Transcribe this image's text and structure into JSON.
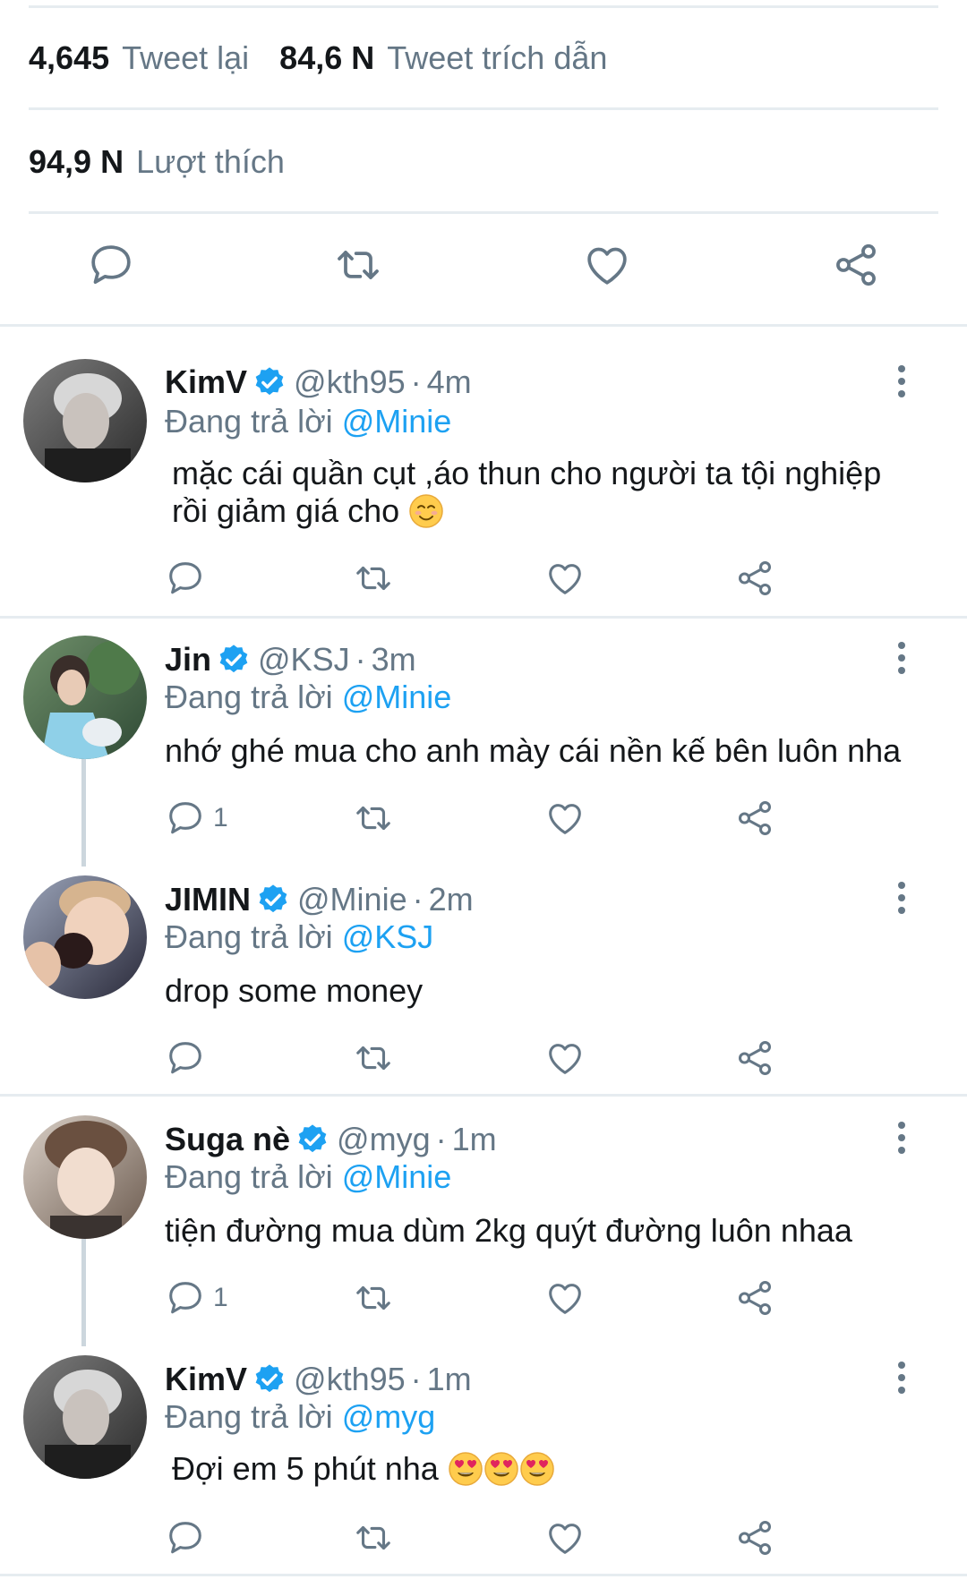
{
  "stats": {
    "retweets_count": "4,645",
    "retweets_label": "Tweet lại",
    "quotes_count": "84,6 N",
    "quotes_label": "Tweet trích dẫn",
    "likes_count": "94,9 N",
    "likes_label": "Lượt thích"
  },
  "colors": {
    "accent": "#1da1f2",
    "muted": "#657786",
    "icon": "#657786",
    "divider": "#e6ecf0",
    "text": "#14171a"
  },
  "icons": {
    "reply": "speech-bubble-icon",
    "retweet": "retweet-arrows-icon",
    "like": "heart-icon",
    "share": "share-nodes-icon",
    "verified": "verified-badge-icon",
    "more": "vertical-ellipsis-icon"
  },
  "replying_prefix": "Đang trả lời",
  "tweets": [
    {
      "name": "KimV",
      "handle": "@kth95",
      "time": "4m",
      "reply_to": "@Minie",
      "text": "mặc cái quần cụt ,áo thun cho người ta tội nghiệp rồi giảm giá cho",
      "emoji": [
        "smiling-face-emoji"
      ],
      "reply_count": ""
    },
    {
      "name": "Jin",
      "handle": "@KSJ",
      "time": "3m",
      "reply_to": "@Minie",
      "text": "nhớ ghé mua cho anh mày cái nền kế bên luôn nha",
      "emoji": [],
      "reply_count": "1"
    },
    {
      "name": "JIMIN",
      "handle": "@Minie",
      "time": "2m",
      "reply_to": "@KSJ",
      "text": "drop some money",
      "emoji": [],
      "reply_count": ""
    },
    {
      "name": "Suga nè",
      "handle": "@myg",
      "time": "1m",
      "reply_to": "@Minie",
      "text": "tiện đường mua dùm 2kg quýt đường luôn nhaa",
      "emoji": [],
      "reply_count": "1"
    },
    {
      "name": "KimV",
      "handle": "@kth95",
      "time": "1m",
      "reply_to": "@myg",
      "text": "Đợi em 5 phút nha",
      "emoji": [
        "heart-eyes-emoji",
        "heart-eyes-emoji",
        "heart-eyes-emoji"
      ],
      "reply_count": ""
    }
  ]
}
